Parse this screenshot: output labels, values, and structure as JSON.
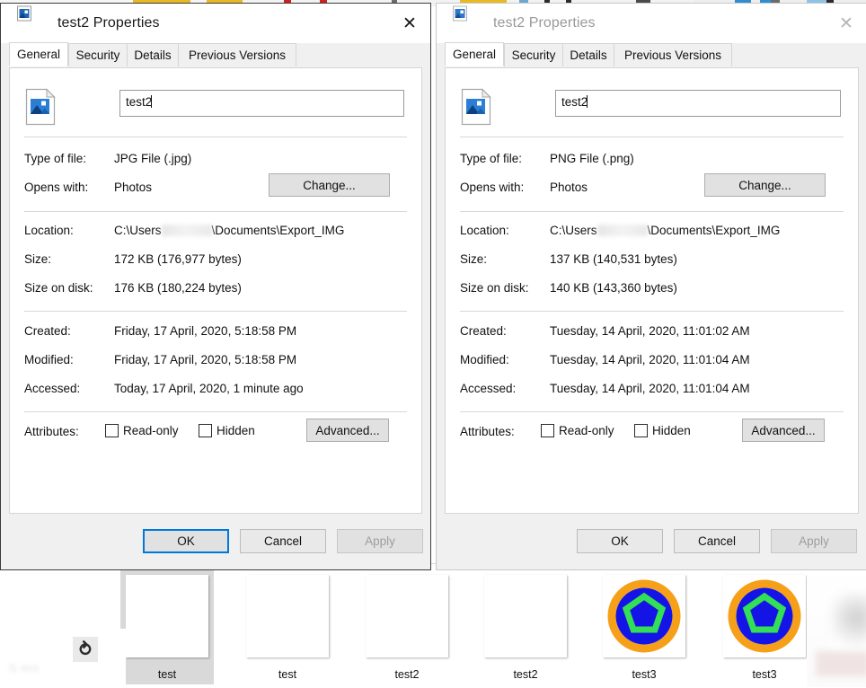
{
  "desktop": {
    "search_placeholder_blurred": "S            ern",
    "cortana_icon": "cortana-icon",
    "thumbnails": [
      {
        "label": "test",
        "texture": "noise",
        "selected": true
      },
      {
        "label": "test",
        "texture": "noise",
        "selected": false
      },
      {
        "label": "test2",
        "texture": "gradient",
        "selected": false
      },
      {
        "label": "test2",
        "texture": "gradient",
        "selected": false
      },
      {
        "label": "test3",
        "texture": "ring",
        "selected": false
      },
      {
        "label": "test3",
        "texture": "ring",
        "selected": false
      }
    ]
  },
  "colors": {
    "accent": "#0078d7",
    "dialog_bg": "#f0f0f0",
    "tab_active_bg": "#ffffff",
    "ring_outer": "#f5a018",
    "ring_inner": "#1414e6",
    "pentagon": "#33e055",
    "gradient_start": "#1a2a9c",
    "gradient_end": "#e8731d"
  },
  "dialogs": [
    {
      "id": "left",
      "active": true,
      "title": "test2 Properties",
      "title_icon": "picture-file-icon",
      "close_icon": "close-icon",
      "tabs": [
        {
          "label": "General",
          "selected": true
        },
        {
          "label": "Security",
          "selected": false
        },
        {
          "label": "Details",
          "selected": false
        },
        {
          "label": "Previous Versions",
          "selected": false
        }
      ],
      "file_icon": "picture-file-icon",
      "filename": "test2",
      "fields": [
        {
          "label": "Type of file:",
          "value": "JPG File (.jpg)"
        },
        {
          "label": "Opens with:",
          "value": "Photos"
        },
        {
          "label": "Location:",
          "value_prefix": "C:\\Users",
          "value_blurred": true,
          "value_suffix": "\\Documents\\Export_IMG"
        },
        {
          "label": "Size:",
          "value": "172 KB (176,977 bytes)"
        },
        {
          "label": "Size on disk:",
          "value": "176 KB (180,224 bytes)"
        },
        {
          "label": "Created:",
          "value": "Friday, 17 April, 2020, 5:18:58 PM"
        },
        {
          "label": "Modified:",
          "value": "Friday, 17 April, 2020, 5:18:58 PM"
        },
        {
          "label": "Accessed:",
          "value": "Today, 17 April, 2020, 1 minute ago"
        },
        {
          "label": "Attributes:",
          "value": ""
        }
      ],
      "change_button": "Change...",
      "advanced_button": "Advanced...",
      "checkboxes": [
        {
          "label": "Read-only",
          "checked": false
        },
        {
          "label": "Hidden",
          "checked": false
        }
      ],
      "buttons": {
        "ok": "OK",
        "cancel": "Cancel",
        "apply": "Apply",
        "apply_enabled": false,
        "ok_focused": true
      }
    },
    {
      "id": "right",
      "active": false,
      "title": "test2 Properties",
      "title_icon": "picture-file-icon",
      "close_icon": "close-icon",
      "tabs": [
        {
          "label": "General",
          "selected": true
        },
        {
          "label": "Security",
          "selected": false
        },
        {
          "label": "Details",
          "selected": false
        },
        {
          "label": "Previous Versions",
          "selected": false
        }
      ],
      "file_icon": "picture-file-icon",
      "filename": "test2",
      "fields": [
        {
          "label": "Type of file:",
          "value": "PNG File (.png)"
        },
        {
          "label": "Opens with:",
          "value": "Photos"
        },
        {
          "label": "Location:",
          "value_prefix": "C:\\Users",
          "value_blurred": true,
          "value_suffix": "\\Documents\\Export_IMG"
        },
        {
          "label": "Size:",
          "value": "137 KB (140,531 bytes)"
        },
        {
          "label": "Size on disk:",
          "value": "140 KB (143,360 bytes)"
        },
        {
          "label": "Created:",
          "value": "Tuesday, 14 April, 2020, 11:01:02 AM"
        },
        {
          "label": "Modified:",
          "value": "Tuesday, 14 April, 2020, 11:01:04 AM"
        },
        {
          "label": "Accessed:",
          "value": "Tuesday, 14 April, 2020, 11:01:04 AM"
        },
        {
          "label": "Attributes:",
          "value": ""
        }
      ],
      "change_button": "Change...",
      "advanced_button": "Advanced...",
      "checkboxes": [
        {
          "label": "Read-only",
          "checked": false
        },
        {
          "label": "Hidden",
          "checked": false
        }
      ],
      "buttons": {
        "ok": "OK",
        "cancel": "Cancel",
        "apply": "Apply",
        "apply_enabled": false,
        "ok_focused": false
      }
    }
  ]
}
